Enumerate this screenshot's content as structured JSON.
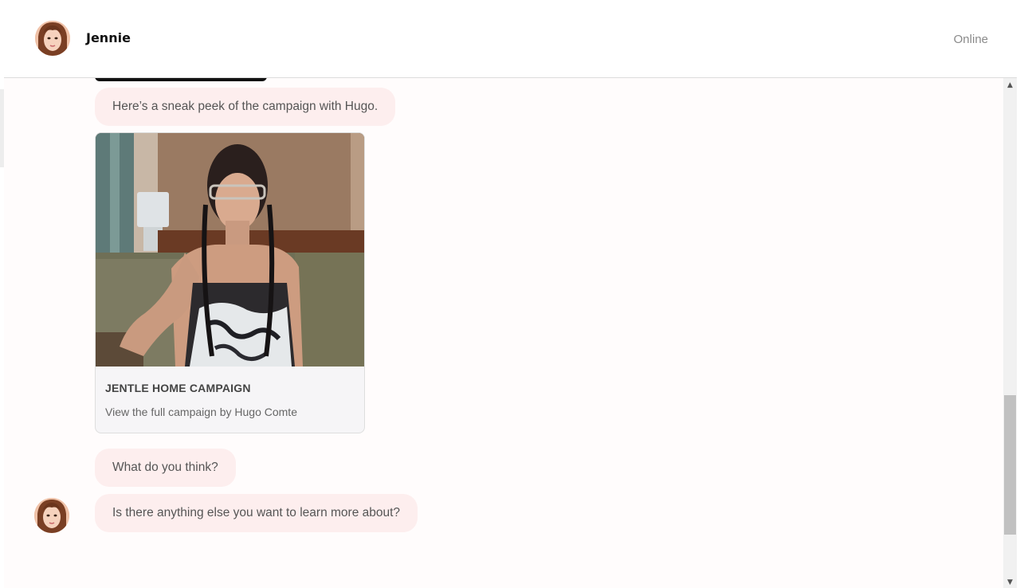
{
  "header": {
    "contact_name": "Jennie",
    "status": "Online"
  },
  "messages": {
    "m1": "Here’s a sneak peek of the campaign with Hugo.",
    "card": {
      "title": "JENTLE HOME CAMPAIGN",
      "subtitle": "View the full campaign by Hugo Comte"
    },
    "m2": "What do you think?",
    "m3": "Is there anything else you want to learn more about?"
  },
  "colors": {
    "bubble": "#fdeeee",
    "chat_bg": "#fffcfc",
    "card_bg": "#f6f5f7"
  },
  "icons": {
    "scroll_up": "chevron-up-icon",
    "scroll_down": "chevron-down-icon"
  }
}
